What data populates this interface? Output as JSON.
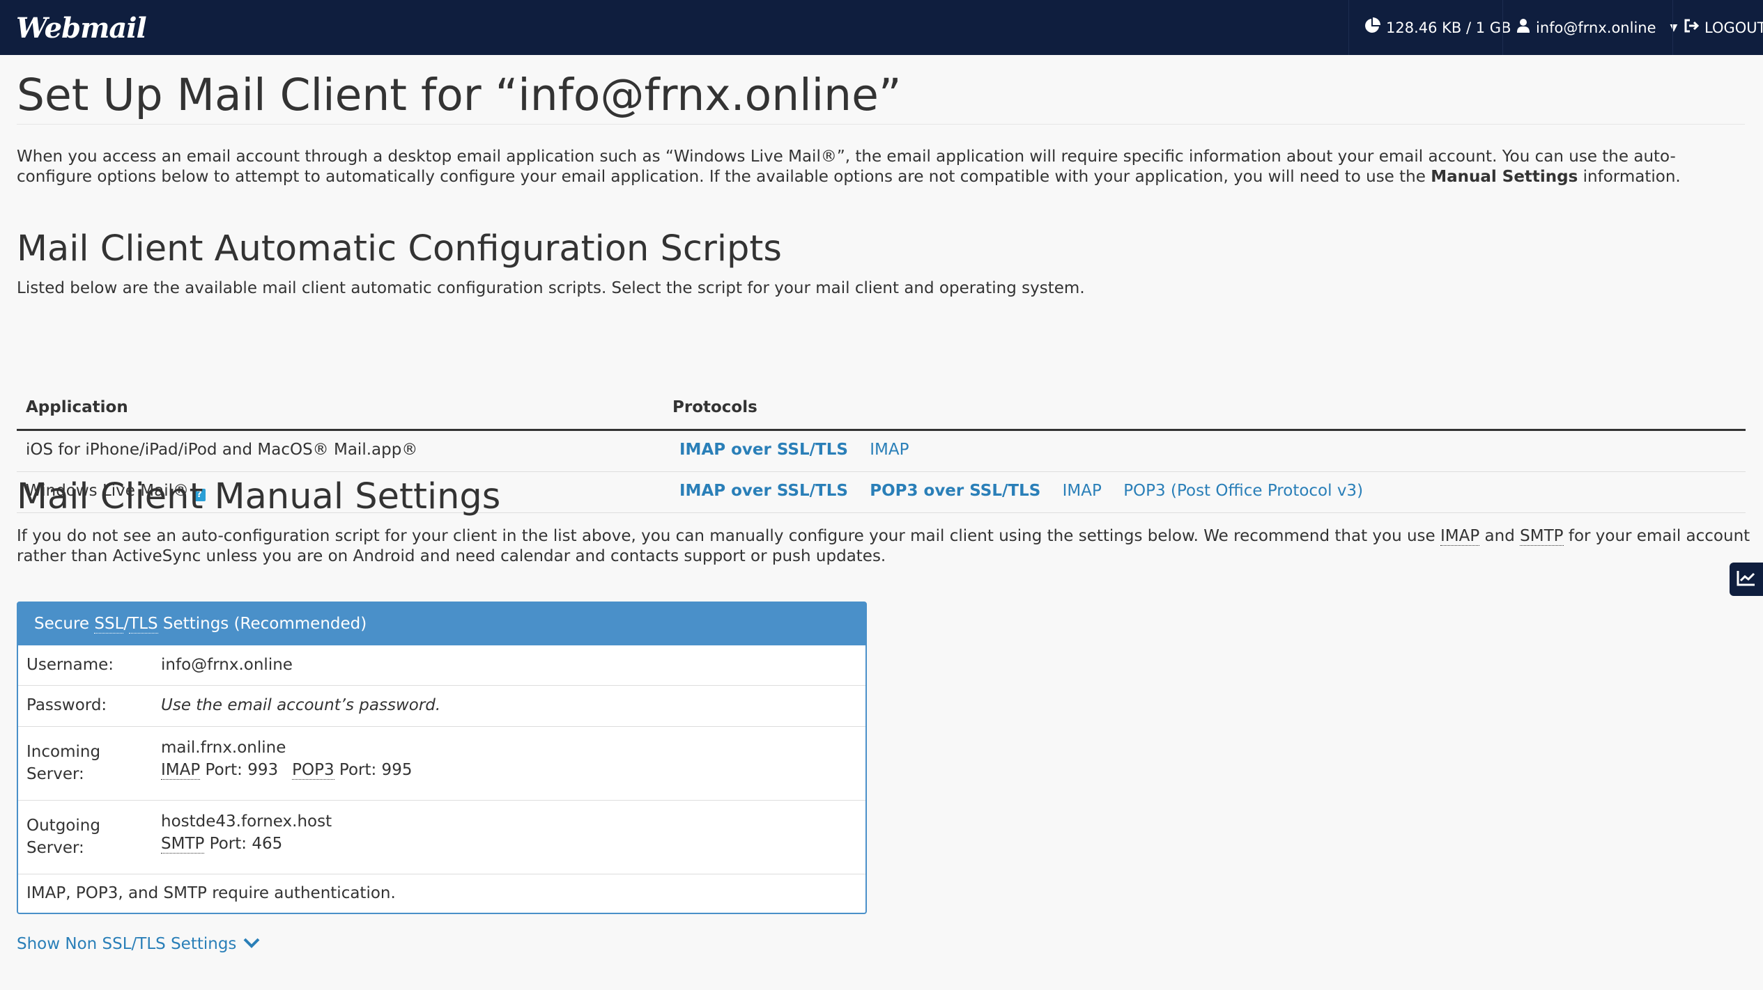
{
  "header": {
    "logo": "Webmail",
    "disk_usage": "128.46 KB / 1 GB",
    "user": "info@frnx.online",
    "logout": "LOGOUT"
  },
  "page": {
    "title": "Set Up Mail Client for “info@frnx.online”",
    "intro_part1": "When you access an email account through a desktop email application such as “Windows Live Mail®”, the email application will require specific information about your email account. You can use the auto-configure options below to attempt to automatically configure your email application. If the available options are not compatible with your application, you will need to use the ",
    "intro_bold": "Manual Settings",
    "intro_part2": " information."
  },
  "auto_config": {
    "heading": "Mail Client Automatic Configuration Scripts",
    "description": "Listed below are the available mail client automatic configuration scripts. Select the script for your mail client and operating system.",
    "columns": [
      "Application",
      "Protocols"
    ],
    "rows": [
      {
        "application": "iOS for iPhone/iPad/iPod and MacOS® Mail.app®",
        "protocols": [
          {
            "label": "IMAP over SSL/TLS",
            "bold": true
          },
          {
            "label": "IMAP",
            "bold": false
          }
        ]
      },
      {
        "application": "Windows Live Mail®",
        "help_icon": "?",
        "protocols": [
          {
            "label": "IMAP over SSL/TLS",
            "bold": true
          },
          {
            "label": "POP3 over SSL/TLS",
            "bold": true
          },
          {
            "label": "IMAP",
            "bold": false
          },
          {
            "label": "POP3 (Post Office Protocol v3)",
            "bold": false
          }
        ]
      }
    ]
  },
  "manual": {
    "heading": "Mail Client Manual Settings",
    "desc_part1": "If you do not see an auto-configuration script for your client in the list above, you can manually configure your mail client using the settings below. We recommend that you use ",
    "desc_imap": "IMAP",
    "desc_and": " and ",
    "desc_smtp": "SMTP",
    "desc_part2": " for your email account rather than ActiveSync unless you are on Android and need calendar and contacts support or push updates."
  },
  "panel": {
    "head_prefix": "Secure ",
    "head_ssl": "SSL",
    "head_slash": "/",
    "head_tls": "TLS",
    "head_suffix": " Settings (Recommended)",
    "username_label": "Username:",
    "username_value": "info@frnx.online",
    "password_label": "Password:",
    "password_value": "Use the email account’s password.",
    "incoming_label_1": "Incoming",
    "incoming_label_2": "Server:",
    "incoming_host": "mail.frnx.online",
    "imap": "IMAP",
    "imap_port": " Port: 993",
    "pop3": "POP3",
    "pop3_port": " Port: 995",
    "outgoing_label_1": "Outgoing",
    "outgoing_label_2": "Server:",
    "outgoing_host": "hostde43.fornex.host",
    "smtp": "SMTP",
    "smtp_port": " Port: 465",
    "auth_note": "IMAP, POP3, and SMTP require authentication."
  },
  "show_non_ssl": "Show Non SSL/TLS Settings",
  "colors": {
    "topbar": "#0f1e3e",
    "link": "#2a7fb8",
    "panel": "#4a90c9"
  },
  "icons": [
    "pie-chart-icon",
    "user-icon",
    "caret-down-icon",
    "logout-icon",
    "help-icon",
    "chevron-down-icon",
    "chart-icon"
  ]
}
